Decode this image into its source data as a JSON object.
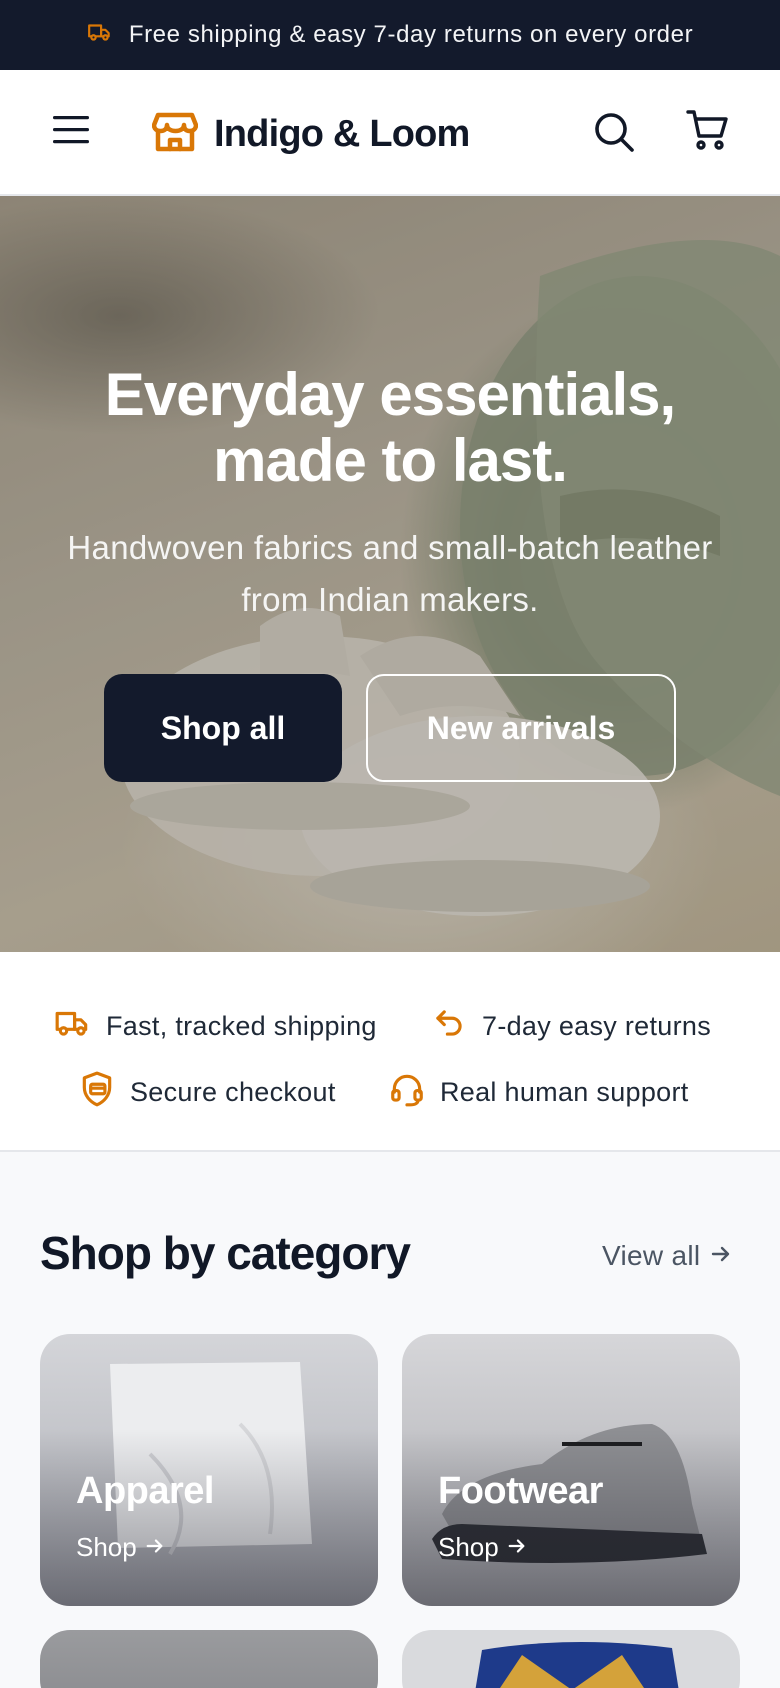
{
  "announcement": {
    "icon": "truck-icon",
    "text": "Free shipping & easy 7-day returns on every order"
  },
  "header": {
    "menu_icon": "hamburger-menu-icon",
    "brand_icon": "storefront-icon",
    "brand_name": "Indigo & Loom",
    "search_icon": "search-icon",
    "cart_icon": "cart-icon"
  },
  "hero": {
    "title_line1": "Everyday essentials,",
    "title_line2": "made to last.",
    "subtitle": "Handwoven fabrics and small-batch leather from Indian makers.",
    "primary_cta": "Shop all",
    "secondary_cta": "New arrivals"
  },
  "features": [
    {
      "icon": "truck-icon",
      "label": "Fast, tracked shipping"
    },
    {
      "icon": "return-arrow-icon",
      "label": "7-day easy returns"
    },
    {
      "icon": "secure-card-icon",
      "label": "Secure checkout"
    },
    {
      "icon": "headset-icon",
      "label": "Real human support"
    }
  ],
  "categories_section": {
    "title": "Shop by category",
    "view_all": "View all",
    "items": [
      {
        "name": "Apparel",
        "link": "Shop"
      },
      {
        "name": "Footwear",
        "link": "Shop"
      }
    ]
  },
  "colors": {
    "accent": "#d97706",
    "dark": "#131a2c",
    "text": "#111827",
    "muted": "#4b5563"
  }
}
